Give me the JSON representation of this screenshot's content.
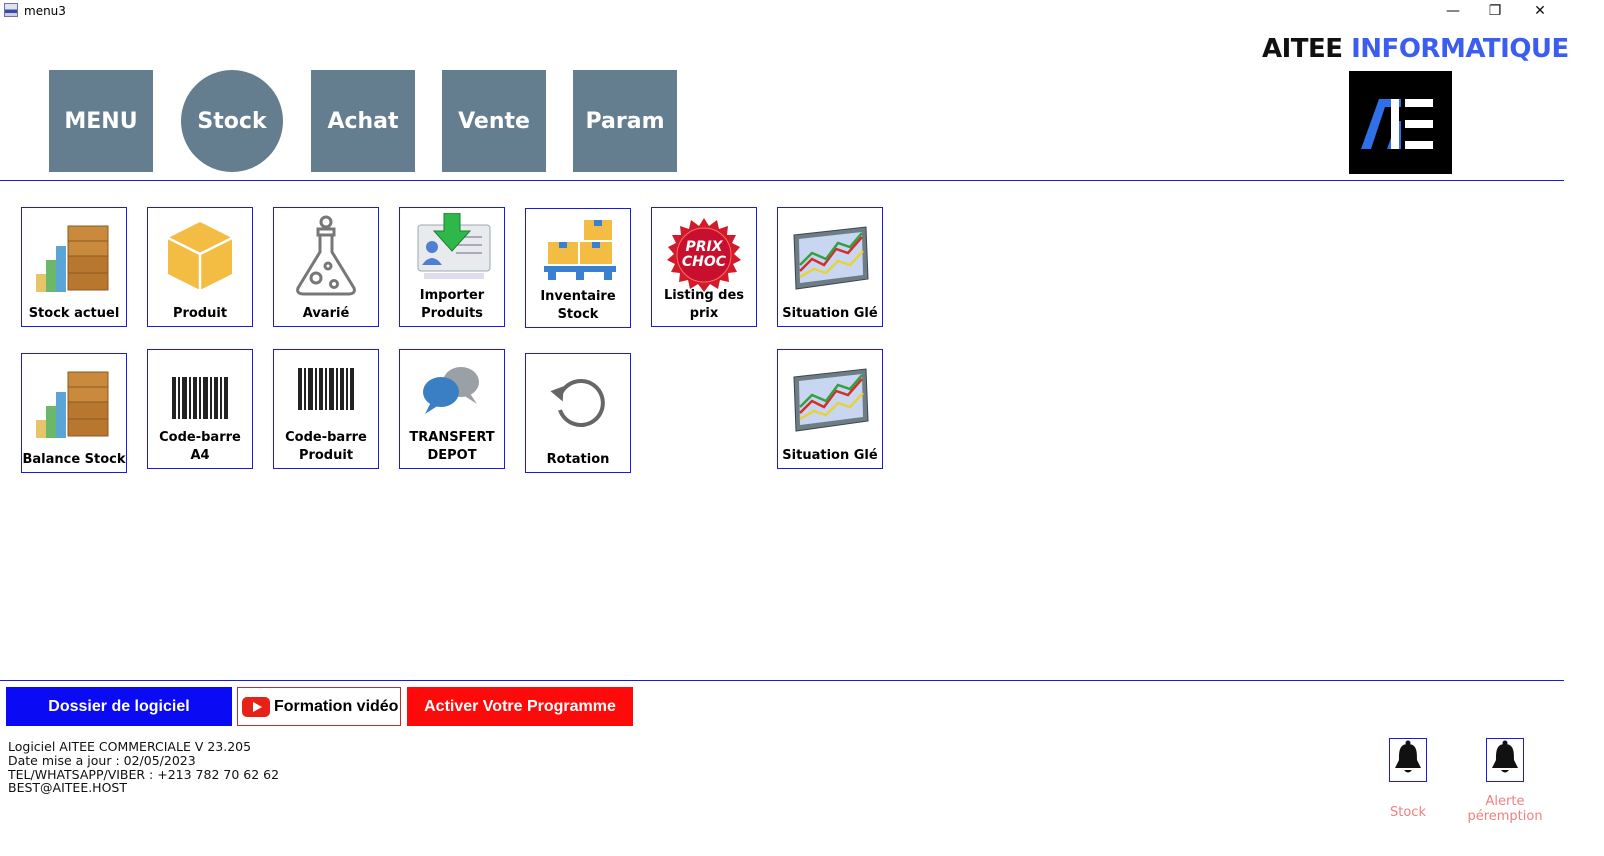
{
  "window": {
    "title": "menu3",
    "minimize": "—",
    "restore": "❐",
    "close": "✕"
  },
  "brand": {
    "part1": "AITEE",
    "part2": "INFORMATIQUE"
  },
  "topnav": [
    "MENU",
    "Stock",
    "Achat",
    "Vente",
    "Param"
  ],
  "tiles": {
    "stock_actuel": "Stock actuel",
    "produit": "Produit",
    "avarie": "Avarié",
    "importer_1": "Importer",
    "importer_2": "Produits",
    "inventaire_1": "Inventaire",
    "inventaire_2": "Stock",
    "listing_prix": "Listing des prix",
    "prix_choc_1": "PRIX",
    "prix_choc_2": "CHOC",
    "situation_1": "Situation Glé",
    "balance_stock": "Balance Stock",
    "codebarre_a4": "Code-barre A4",
    "codebarre_produit_1": "Code-barre",
    "codebarre_produit_2": "Produit",
    "transfert_1": "TRANSFERT",
    "transfert_2": "DEPOT",
    "rotation": "Rotation",
    "situation_2": "Situation Glé"
  },
  "bottom": {
    "dossier": "Dossier de logiciel",
    "formation": "Formation vidéo",
    "activer": "Activer Votre Programme"
  },
  "info": {
    "line1": "Logiciel AITEE COMMERCIALE V 23.205",
    "line2": "Date mise a jour : 02/05/2023",
    "line3": "TEL/WHATSAPP/VIBER : +213 782 70 62 62",
    "line4": "BEST@AITEE.HOST"
  },
  "alerts": {
    "stock": "Stock",
    "peremption_1": "Alerte",
    "peremption_2": "péremption"
  },
  "colors": {
    "nav": "#647d8f",
    "border": "#1a1ae0",
    "blue_btn": "#0a0af5",
    "red_btn": "#ff0a0a",
    "brand_blue": "#3c5ef0"
  },
  "icons": [
    "app-icon",
    "boxes-chart-icon",
    "cube-icon",
    "flask-icon",
    "import-arrow-icon",
    "pallet-boxes-icon",
    "prix-choc-badge-icon",
    "line-chart-icon",
    "barcode-icon",
    "chat-bubbles-icon",
    "rotate-icon",
    "youtube-play-icon",
    "bell-icon"
  ]
}
